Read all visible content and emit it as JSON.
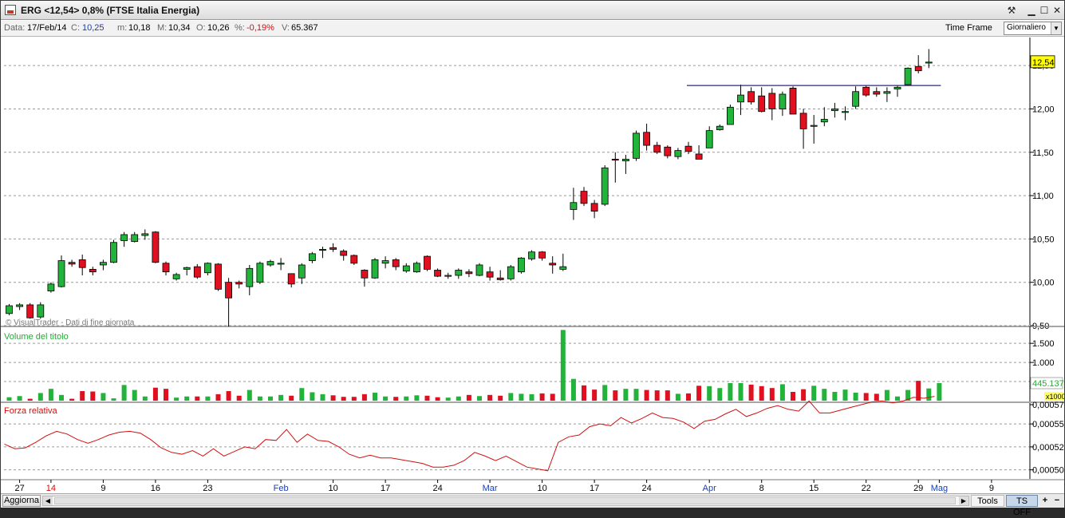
{
  "window": {
    "title": "ERG <12,54> 0,8%  (FTSE Italia Energia)"
  },
  "infobar": {
    "date_label": "Data:",
    "date_value": "17/Feb/14",
    "close_label": "C:",
    "close_value": "10,25",
    "min_label": "m:",
    "min_value": "10,18",
    "max_label": "M:",
    "max_value": "10,34",
    "open_label": "O:",
    "open_value": "10,26",
    "pct_label": "%:",
    "pct_value": "-0,19%",
    "vol_label": "V:",
    "vol_value": "65.367",
    "time_frame_label": "Time Frame",
    "time_frame_value": "Giornaliero"
  },
  "colors": {
    "up": "#22b33a",
    "down": "#e01020",
    "grid": "#9a9a9a",
    "rs_line": "#d01010",
    "hline": "#2a2a8a",
    "last_price_bg": "#ffff00"
  },
  "chart_data": [
    {
      "type": "candlestick",
      "title": "",
      "watermark": "© VisualTrader - Dati di fine giornata",
      "last_price_label": "12,54",
      "ylim": [
        9.5,
        12.75
      ],
      "y_ticks": [
        "9,50",
        "10,00",
        "10,50",
        "11,00",
        "11,50",
        "12,00",
        "12,50"
      ],
      "y_tick_values": [
        9.5,
        10.0,
        10.5,
        11.0,
        11.5,
        12.0,
        12.5
      ],
      "x_labels": [
        {
          "i": 1,
          "text": "27",
          "color": "#000000"
        },
        {
          "i": 4,
          "text": "14",
          "color": "#d01010"
        },
        {
          "i": 9,
          "text": "9",
          "color": "#000000"
        },
        {
          "i": 14,
          "text": "16",
          "color": "#000000"
        },
        {
          "i": 19,
          "text": "23",
          "color": "#000000"
        },
        {
          "i": 26,
          "text": "Feb",
          "color": "#1a3fb0"
        },
        {
          "i": 31,
          "text": "10",
          "color": "#000000"
        },
        {
          "i": 36,
          "text": "17",
          "color": "#000000"
        },
        {
          "i": 41,
          "text": "24",
          "color": "#000000"
        },
        {
          "i": 46,
          "text": "Mar",
          "color": "#1a3fb0"
        },
        {
          "i": 51,
          "text": "10",
          "color": "#000000"
        },
        {
          "i": 56,
          "text": "17",
          "color": "#000000"
        },
        {
          "i": 61,
          "text": "24",
          "color": "#000000"
        },
        {
          "i": 67,
          "text": "Apr",
          "color": "#1a3fb0"
        },
        {
          "i": 72,
          "text": "8",
          "color": "#000000"
        },
        {
          "i": 77,
          "text": "15",
          "color": "#000000"
        },
        {
          "i": 82,
          "text": "22",
          "color": "#000000"
        },
        {
          "i": 87,
          "text": "29",
          "color": "#000000"
        },
        {
          "i": 89,
          "text": "Mag",
          "color": "#1a3fb0"
        },
        {
          "i": 94,
          "text": "9",
          "color": "#000000"
        }
      ],
      "resistance_line": {
        "from_i": 65,
        "to_i": 89,
        "value": 12.27
      },
      "ohlc": [
        [
          9.64,
          9.75,
          9.62,
          9.73
        ],
        [
          9.72,
          9.76,
          9.68,
          9.74
        ],
        [
          9.74,
          9.76,
          9.58,
          9.59
        ],
        [
          9.6,
          9.77,
          9.58,
          9.74
        ],
        [
          9.9,
          10.0,
          9.88,
          9.98
        ],
        [
          9.95,
          10.31,
          9.94,
          10.25
        ],
        [
          10.23,
          10.26,
          10.18,
          10.21
        ],
        [
          10.26,
          10.32,
          10.08,
          10.17
        ],
        [
          10.15,
          10.18,
          10.08,
          10.12
        ],
        [
          10.2,
          10.26,
          10.14,
          10.23
        ],
        [
          10.23,
          10.49,
          10.22,
          10.46
        ],
        [
          10.48,
          10.58,
          10.41,
          10.55
        ],
        [
          10.47,
          10.58,
          10.46,
          10.55
        ],
        [
          10.54,
          10.61,
          10.49,
          10.56
        ],
        [
          10.58,
          10.59,
          10.22,
          10.23
        ],
        [
          10.22,
          10.24,
          10.08,
          10.12
        ],
        [
          10.04,
          10.11,
          10.02,
          10.09
        ],
        [
          10.15,
          10.18,
          10.08,
          10.17
        ],
        [
          10.18,
          10.21,
          10.04,
          10.06
        ],
        [
          10.11,
          10.23,
          10.08,
          10.22
        ],
        [
          10.21,
          10.22,
          9.9,
          9.92
        ],
        [
          10.0,
          10.05,
          9.49,
          9.82
        ],
        [
          10.0,
          10.02,
          9.93,
          9.98
        ],
        [
          9.95,
          10.2,
          9.85,
          10.16
        ],
        [
          10.0,
          10.24,
          9.98,
          10.22
        ],
        [
          10.2,
          10.26,
          10.18,
          10.24
        ],
        [
          10.22,
          10.28,
          10.14,
          10.22
        ],
        [
          10.1,
          10.1,
          9.94,
          9.98
        ],
        [
          10.05,
          10.22,
          9.98,
          10.2
        ],
        [
          10.25,
          10.35,
          10.22,
          10.33
        ],
        [
          10.38,
          10.41,
          10.28,
          10.38
        ],
        [
          10.4,
          10.45,
          10.35,
          10.38
        ],
        [
          10.36,
          10.38,
          10.25,
          10.31
        ],
        [
          10.31,
          10.32,
          10.2,
          10.22
        ],
        [
          10.14,
          10.15,
          9.95,
          10.05
        ],
        [
          10.05,
          10.28,
          10.04,
          10.26
        ],
        [
          10.22,
          10.3,
          10.16,
          10.25
        ],
        [
          10.26,
          10.28,
          10.14,
          10.18
        ],
        [
          10.13,
          10.22,
          10.11,
          10.19
        ],
        [
          10.12,
          10.24,
          10.11,
          10.22
        ],
        [
          10.3,
          10.31,
          10.13,
          10.15
        ],
        [
          10.14,
          10.16,
          10.06,
          10.07
        ],
        [
          10.08,
          10.11,
          10.04,
          10.08
        ],
        [
          10.08,
          10.16,
          10.04,
          10.14
        ],
        [
          10.12,
          10.15,
          10.06,
          10.1
        ],
        [
          10.08,
          10.22,
          10.07,
          10.2
        ],
        [
          10.12,
          10.18,
          10.02,
          10.06
        ],
        [
          10.05,
          10.14,
          10.02,
          10.03
        ],
        [
          10.04,
          10.2,
          10.02,
          10.18
        ],
        [
          10.12,
          10.29,
          10.1,
          10.28
        ],
        [
          10.27,
          10.37,
          10.25,
          10.35
        ],
        [
          10.35,
          10.36,
          10.25,
          10.28
        ],
        [
          10.22,
          10.3,
          10.1,
          10.2
        ],
        [
          10.15,
          10.33,
          10.13,
          10.18
        ],
        [
          10.84,
          11.09,
          10.72,
          10.92
        ],
        [
          11.05,
          11.1,
          10.88,
          10.91
        ],
        [
          10.91,
          10.95,
          10.74,
          10.82
        ],
        [
          10.9,
          11.35,
          10.88,
          11.32
        ],
        [
          11.42,
          11.5,
          11.15,
          11.41
        ],
        [
          11.4,
          11.47,
          11.25,
          11.42
        ],
        [
          11.43,
          11.75,
          11.4,
          11.72
        ],
        [
          11.73,
          11.83,
          11.52,
          11.58
        ],
        [
          11.58,
          11.62,
          11.48,
          11.5
        ],
        [
          11.56,
          11.58,
          11.43,
          11.46
        ],
        [
          11.45,
          11.55,
          11.42,
          11.52
        ],
        [
          11.57,
          11.62,
          11.48,
          11.51
        ],
        [
          11.48,
          11.58,
          11.42,
          11.42
        ],
        [
          11.55,
          11.8,
          11.55,
          11.75
        ],
        [
          11.76,
          11.82,
          11.75,
          11.8
        ],
        [
          11.82,
          12.05,
          11.82,
          12.02
        ],
        [
          12.08,
          12.28,
          11.93,
          12.16
        ],
        [
          12.2,
          12.25,
          12.05,
          12.08
        ],
        [
          12.15,
          12.25,
          11.96,
          11.97
        ],
        [
          12.18,
          12.24,
          11.87,
          12.0
        ],
        [
          12.0,
          12.2,
          11.92,
          12.17
        ],
        [
          12.24,
          12.26,
          11.95,
          11.94
        ],
        [
          11.95,
          12.0,
          11.54,
          11.77
        ],
        [
          11.8,
          11.93,
          11.6,
          11.81
        ],
        [
          11.85,
          12.02,
          11.8,
          11.88
        ],
        [
          11.98,
          12.07,
          11.9,
          12.0
        ],
        [
          11.96,
          12.03,
          11.87,
          11.97
        ],
        [
          12.03,
          12.26,
          12.0,
          12.2
        ],
        [
          12.25,
          12.27,
          12.14,
          12.16
        ],
        [
          12.2,
          12.25,
          12.14,
          12.17
        ],
        [
          12.18,
          12.25,
          12.08,
          12.2
        ],
        [
          12.23,
          12.27,
          12.14,
          12.25
        ],
        [
          12.28,
          12.48,
          12.27,
          12.47
        ],
        [
          12.49,
          12.62,
          12.41,
          12.44
        ],
        [
          12.53,
          12.69,
          12.47,
          12.54
        ]
      ]
    },
    {
      "type": "bar",
      "title": "Volume del titolo",
      "y_ticks": [
        "1.000",
        "1.500"
      ],
      "y_tick_values": [
        1000,
        1500
      ],
      "last_value_label": "445.137",
      "unit_label": "x1000",
      "ylim": [
        0,
        1900
      ],
      "values": [
        90,
        120,
        50,
        200,
        310,
        150,
        50,
        250,
        240,
        200,
        60,
        410,
        280,
        110,
        340,
        310,
        80,
        110,
        110,
        110,
        170,
        250,
        130,
        280,
        110,
        110,
        150,
        130,
        330,
        220,
        170,
        140,
        100,
        100,
        170,
        210,
        110,
        100,
        110,
        140,
        130,
        90,
        80,
        110,
        150,
        120,
        150,
        130,
        200,
        180,
        170,
        190,
        180,
        1850,
        570,
        400,
        290,
        410,
        270,
        310,
        310,
        280,
        270,
        270,
        180,
        190,
        390,
        380,
        330,
        460,
        460,
        420,
        380,
        330,
        430,
        230,
        300,
        390,
        310,
        230,
        290,
        210,
        200,
        180,
        280,
        110,
        280,
        520,
        320,
        460
      ]
    },
    {
      "type": "line",
      "title": "Forza relativa",
      "ylim": [
        0.000496,
        0.000576
      ],
      "y_ticks": [
        "0,00050",
        "0,00052",
        "0,00055",
        "0,00057"
      ],
      "y_tick_values": [
        0.000505,
        0.00053,
        0.000555,
        0.00058
      ],
      "values": [
        0.000533,
        0.000528,
        0.000529,
        0.000535,
        0.000542,
        0.000547,
        0.000544,
        0.000538,
        0.000534,
        0.000538,
        0.000543,
        0.000546,
        0.000547,
        0.000545,
        0.000538,
        0.000529,
        0.000524,
        0.000522,
        0.000526,
        0.00052,
        0.000528,
        0.00052,
        0.000525,
        0.00053,
        0.000528,
        0.000538,
        0.000537,
        0.000549,
        0.000535,
        0.000544,
        0.000537,
        0.000536,
        0.00053,
        0.000522,
        0.000518,
        0.000521,
        0.000518,
        0.000518,
        0.000516,
        0.000514,
        0.000512,
        0.000508,
        0.000508,
        0.00051,
        0.000515,
        0.000524,
        0.00052,
        0.000515,
        0.00052,
        0.000514,
        0.000508,
        0.000506,
        0.000504,
        0.000535,
        0.000541,
        0.000543,
        0.000552,
        0.000555,
        0.000553,
        0.000562,
        0.000556,
        0.000561,
        0.000567,
        0.000562,
        0.000561,
        0.000557,
        0.00055,
        0.000558,
        0.00056,
        0.000566,
        0.000571,
        0.000563,
        0.000567,
        0.000572,
        0.000575,
        0.000571,
        0.000569,
        0.00058,
        0.000567,
        0.000567,
        0.00057,
        0.000573,
        0.000576,
        0.000579,
        0.00058,
        0.000578,
        0.00058,
        0.000584,
        0.000583,
        0.000585
      ]
    }
  ],
  "toolbar": {
    "aggiorna_label": "Aggiorna",
    "tools_label": "Tools",
    "tsoff_label": "TS OFF",
    "plus_label": "+",
    "minus_label": "−",
    "scroll_left_glyph": "◀",
    "scroll_right_glyph": "▶"
  },
  "icons": {
    "tool_glyph": "⚒",
    "minimize_glyph": "▁",
    "maximize_glyph": "☐",
    "close_glyph": "✕",
    "dropdown_glyph": "▼"
  }
}
